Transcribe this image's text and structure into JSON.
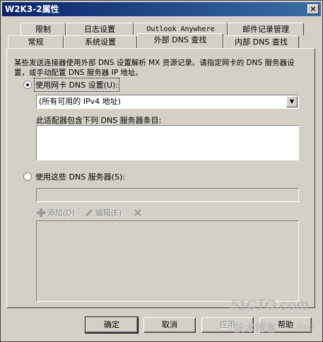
{
  "window": {
    "title": "W2K3-2属性",
    "close_glyph": "×"
  },
  "tabs_back": [
    "限制",
    "日志设置",
    "Outlook Anywhere",
    "邮件记录管理"
  ],
  "tabs_front": [
    "常规",
    "系统设置",
    "外部 DNS 查找",
    "内部 DNS 查找"
  ],
  "panel": {
    "description": "某些发送连接器使用外部 DNS 设置解析 MX 资源记录。请指定网卡的 DNS 服务器设置，或手动配置 DNS 服务器 IP 地址。",
    "option_adapter": "使用网卡 DNS 设置(U):",
    "adapter_select_value": "(所有可用的 IPv4 地址)",
    "adapter_list_label": "此适配器包含下列 DNS 服务器条目:",
    "option_servers": "使用这些 DNS 服务器(S):",
    "add_label": "添加(D)",
    "edit_label": "编辑(E)"
  },
  "buttons": {
    "ok": "确定",
    "cancel": "取消",
    "apply": "应用",
    "help": "帮助"
  },
  "watermark": {
    "site": "51CTO.com",
    "sub": "技术博客",
    "blog": "Blog"
  }
}
